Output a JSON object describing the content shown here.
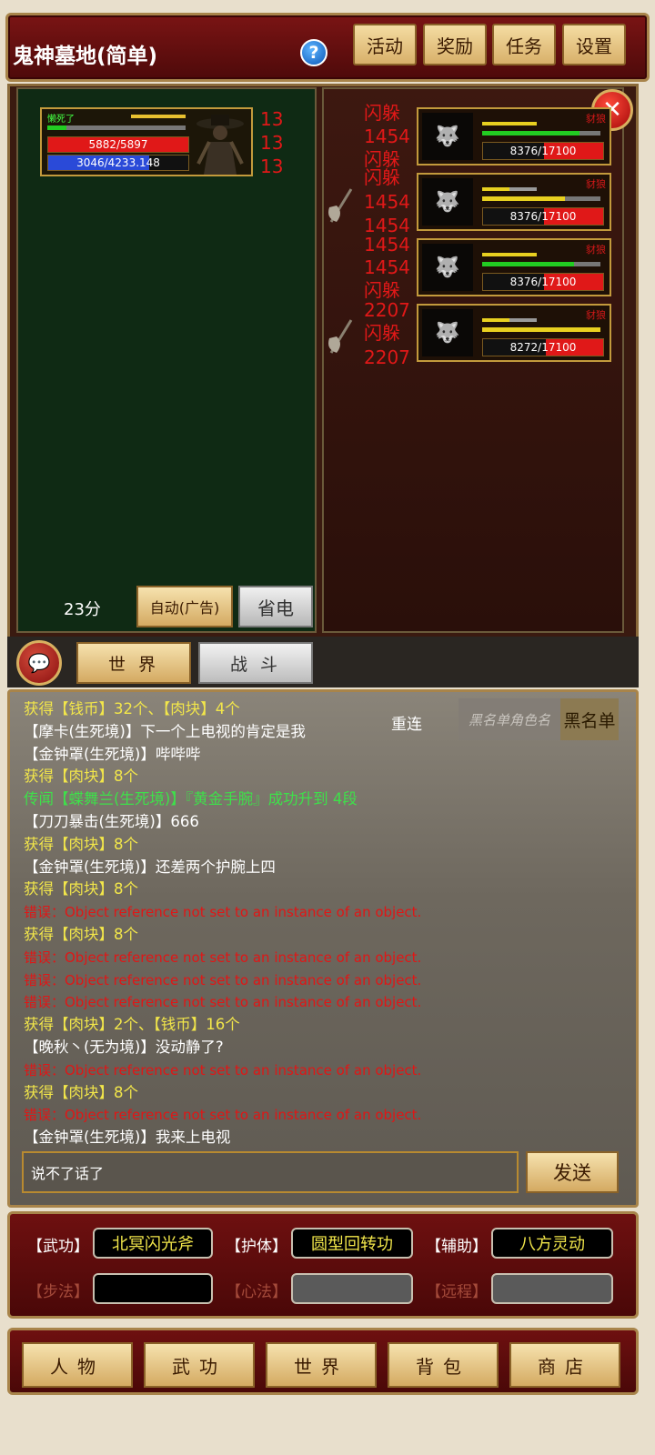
{
  "header": {
    "title": "鬼神墓地(简单)",
    "help_icon": "?",
    "buttons": [
      "活动",
      "奖励",
      "任务",
      "设置"
    ]
  },
  "player": {
    "status": "懒死了",
    "hp_text": "5882/5897",
    "hp_ratio": 0.997,
    "mp_text": "3046/4233.148",
    "mp_ratio": 0.72,
    "damage_numbers": [
      "13",
      "13",
      "13"
    ]
  },
  "enemy_log": [
    "闪躲",
    "1454",
    "闪躲",
    "闪躲",
    "1454",
    "1454",
    "1454",
    "1454",
    "闪躲",
    "2207",
    "闪躲",
    "2207"
  ],
  "enemies": [
    {
      "name": "豺狼",
      "hp_text": "8376/17100",
      "hp_ratio": 0.49
    },
    {
      "name": "豺狼",
      "hp_text": "8376/17100",
      "hp_ratio": 0.49
    },
    {
      "name": "豺狼",
      "hp_text": "8376/17100",
      "hp_ratio": 0.49
    },
    {
      "name": "豺狼",
      "hp_text": "8272/17100",
      "hp_ratio": 0.48
    }
  ],
  "battle_controls": {
    "score": "23分",
    "auto_label": "自动(广告)",
    "power_save_label": "省电"
  },
  "chat_tabs": [
    "世 界",
    "战 斗"
  ],
  "chat": {
    "lines": [
      {
        "text": "获得【钱币】32个、【肉块】4个",
        "color": "yellow"
      },
      {
        "text": "【摩卡(生死境)】下一个上电视的肯定是我",
        "color": "white"
      },
      {
        "text": "【金钟罩(生死境)】哔哔哔",
        "color": "white"
      },
      {
        "text": "获得【肉块】8个",
        "color": "yellow"
      },
      {
        "text": "传闻【蝶舞兰(生死境)】『黄金手腕』成功升到 4段",
        "color": "green"
      },
      {
        "text": "【刀刀暴击(生死境)】666",
        "color": "white"
      },
      {
        "text": "获得【肉块】8个",
        "color": "yellow"
      },
      {
        "text": "【金钟罩(生死境)】还差两个护腕上四",
        "color": "white"
      },
      {
        "text": "获得【肉块】8个",
        "color": "yellow"
      },
      {
        "text": "错误：Object reference not set to an instance of an object.",
        "color": "red"
      },
      {
        "text": "获得【肉块】8个",
        "color": "yellow"
      },
      {
        "text": "错误：Object reference not set to an instance of an object.",
        "color": "red"
      },
      {
        "text": "错误：Object reference not set to an instance of an object.",
        "color": "red"
      },
      {
        "text": "错误：Object reference not set to an instance of an object.",
        "color": "red"
      },
      {
        "text": "获得【肉块】2个、【钱币】16个",
        "color": "yellow"
      },
      {
        "text": "【晚秋丶(无为境)】没动静了?",
        "color": "white"
      },
      {
        "text": "错误：Object reference not set to an instance of an object.",
        "color": "red"
      },
      {
        "text": "获得【肉块】8个",
        "color": "yellow"
      },
      {
        "text": "错误：Object reference not set to an instance of an object.",
        "color": "red"
      },
      {
        "text": "【金钟罩(生死境)】我来上电视",
        "color": "white"
      }
    ],
    "reconnect_label": "重连",
    "blacklist_placeholder": "黑名单角色名",
    "blacklist_button": "黑名单",
    "input_value": "说不了话了",
    "send_label": "发送"
  },
  "skills": {
    "row1": [
      {
        "label": "【武功】",
        "value": "北冥闪光斧"
      },
      {
        "label": "【护体】",
        "value": "圆型回转功"
      },
      {
        "label": "【辅助】",
        "value": "八方灵动"
      }
    ],
    "row2": [
      {
        "label": "【步法】",
        "value": ""
      },
      {
        "label": "【心法】",
        "value": ""
      },
      {
        "label": "【远程】",
        "value": ""
      }
    ]
  },
  "bottom_nav": [
    "人物",
    "武功",
    "世界",
    "背包",
    "商店"
  ],
  "colors": {
    "header_red": "#6a1010",
    "gold_button": "#e8c584",
    "damage_red": "#e01818",
    "chat_yellow": "#f2e64a",
    "chat_green": "#3ee04a",
    "hp_red": "#e01818",
    "mp_blue": "#2a4ad8",
    "enemy_hp_green": "#22cc22",
    "enemy_hp_yellow": "#e8d020"
  }
}
